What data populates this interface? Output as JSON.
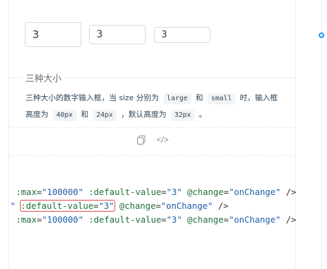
{
  "inputs": [
    {
      "size": "large",
      "value": "3"
    },
    {
      "size": "default",
      "value": "3"
    },
    {
      "size": "small",
      "value": "3"
    }
  ],
  "section": {
    "title": "三种大小",
    "desc_prefix": "三种大小的数字输入框，当 size 分别为",
    "tag_large": "large",
    "and1": "和",
    "tag_small": "small",
    "desc_mid": "时，输入框高度为",
    "tag_40": "40px",
    "and2": "和",
    "tag_24": "24px",
    "desc_mid2": "，默认高度为",
    "tag_32": "32px",
    "desc_end": "。"
  },
  "actions": {
    "copy_icon": "copy-icon",
    "code_icon": "code-icon",
    "code_text": "</>"
  },
  "code": {
    "line1": {
      "a1": ":max",
      "eq1": "=",
      "v1": "\"100000\"",
      "a2": " :default-value",
      "eq2": "=",
      "v2": "\"3\"",
      "a3": " @change",
      "eq3": "=",
      "v3": "\"onChange\"",
      "end": " />"
    },
    "line2": {
      "lead": "\" ",
      "a1": ":default-value",
      "eq1": "=",
      "v1": "\"3\"",
      "a2": " @change",
      "eq2": "=",
      "v2": "\"onChange\"",
      "end": " />"
    },
    "line3": {
      "a1": ":max",
      "eq1": "=",
      "v1": "\"100000\"",
      "a2": " :default-value",
      "eq2": "=",
      "v2": "\"3\"",
      "a3": " @change",
      "eq3": "=",
      "v3": "\"onChange\"",
      "end": " />"
    }
  },
  "colors": {
    "accent": "#1890ff",
    "highlight": "#e04a4a"
  }
}
